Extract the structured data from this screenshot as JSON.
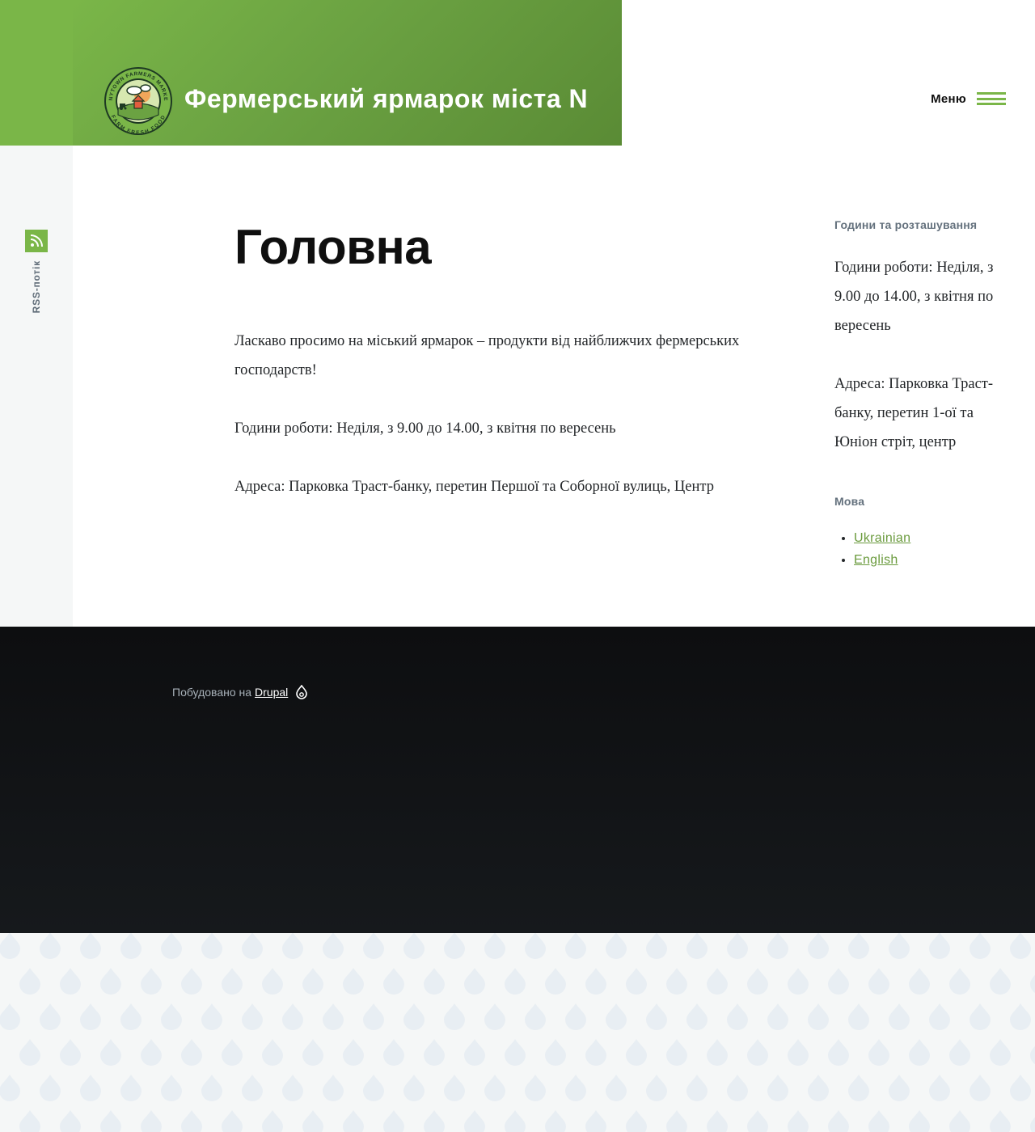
{
  "header": {
    "site_name": "Фермерський ярмарок міста N",
    "logo_alt_top": "ANYTOWN FARMERS MARKET",
    "logo_alt_bottom": "FARM FRESH FOOD",
    "menu_label": "Меню"
  },
  "social": {
    "rss_label": "RSS-потік"
  },
  "main": {
    "title": "Головна",
    "paragraphs": [
      "Ласкаво просимо на міський ярмарок – продукти від найближчих фермерських господарств!",
      "Години роботи: Неділя, з 9.00 до 14.00, з квітня по вересень",
      "Адреса: Парковка Траст-банку, перетин Першої та Соборної вулиць, Центр"
    ]
  },
  "sidebar": {
    "hours_block": {
      "title": "Години та розташування",
      "hours": "Години роботи: Неділя, з 9.00 до 14.00, з квітня по вересень",
      "address": "Адреса: Парковка Траст-банку, перетин 1-ої та Юніон стріт, центр"
    },
    "language_block": {
      "title": "Мова",
      "languages": [
        "Ukrainian",
        "English"
      ]
    }
  },
  "footer": {
    "powered_by": "Побудовано на",
    "drupal_link": "Drupal"
  },
  "colors": {
    "brand_green": "#7ab648",
    "link_green": "#6b9b3e",
    "footer_dark": "#0d0e10",
    "sidebar_bg": "#f5f7f7",
    "pattern_drop": "#e8eef3"
  }
}
